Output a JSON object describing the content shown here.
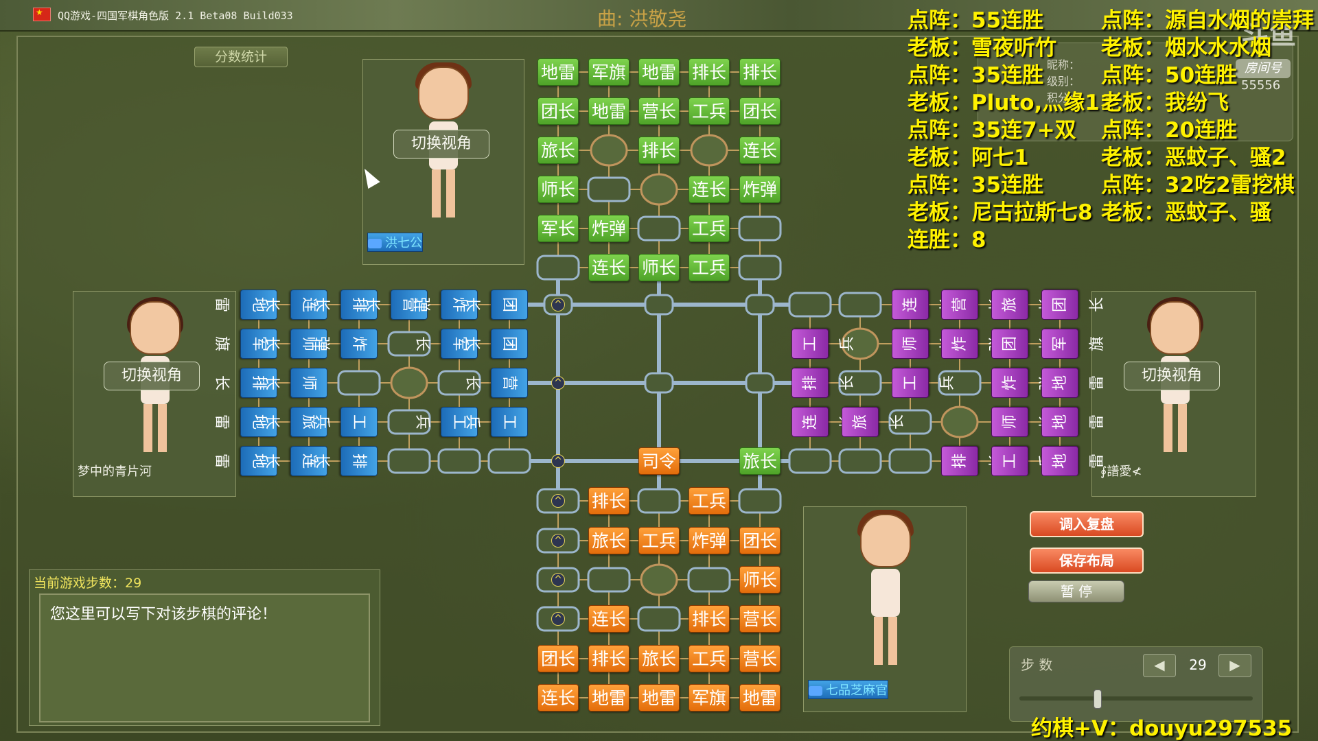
{
  "title_bar": {
    "app_title": "QQ游戏-四国军棋角色版 2.1 Beta08 Build033",
    "song": "曲: 洪敬尧"
  },
  "score_button": "分数统计",
  "players": {
    "top": {
      "name": "洪七公",
      "view_button": "切换视角"
    },
    "left": {
      "name": "梦中的青片河",
      "view_button": "切换视角"
    },
    "right": {
      "name": "∮譜愛≮",
      "view_button": "切换视角"
    },
    "bottom": {
      "name": "七品芝麻官"
    }
  },
  "overlay_left": [
    "点阵：55连胜",
    "老板：雪夜听竹",
    "点阵：35连胜",
    "老板：Pluto,灬缘11",
    "点阵：35连7+双",
    "老板：阿七1",
    "点阵：35连胜",
    "老板：尼古拉斯七8",
    "连胜：8"
  ],
  "overlay_right": [
    "点阵：源自水烟的崇拜",
    "老板：烟水水水烟",
    "点阵：50连胜",
    "老板：我纷飞",
    "点阵：20连胜",
    "老板：恶蚊子、骚2",
    "点阵：32吃2雷挖棋",
    "老板：恶蚊子、骚"
  ],
  "room_info": {
    "nickname_label": "昵称：",
    "level_label": "级别：",
    "points_label": "积分：",
    "room_tag": "房间号",
    "room_number": "55556"
  },
  "logo": "斗鱼",
  "board": {
    "top_pieces": [
      [
        "地雷",
        "军旗",
        "地雷",
        "排长",
        "排长"
      ],
      [
        "团长",
        "地雷",
        "营长",
        "工兵",
        "团长"
      ],
      [
        "旅长",
        "",
        "排长",
        "",
        "连长"
      ],
      [
        "师长",
        "",
        "",
        "连长",
        "炸弹"
      ],
      [
        "军长",
        "炸弹",
        "",
        "工兵",
        ""
      ],
      [
        "",
        "连长",
        "师长",
        "工兵",
        ""
      ]
    ],
    "bottom_pieces": [
      [
        "",
        "排长",
        "",
        "工兵",
        ""
      ],
      [
        "",
        "旅长",
        "工兵",
        "炸弹",
        "团长"
      ],
      [
        "",
        "",
        "",
        "",
        "师长"
      ],
      [
        "",
        "连长",
        "",
        "排长",
        "营长"
      ],
      [
        "团长",
        "排长",
        "旅长",
        "工兵",
        "营长"
      ],
      [
        "连长",
        "地雷",
        "地雷",
        "军旗",
        "地雷"
      ]
    ],
    "left_pieces": [
      [
        "地雷",
        "连长",
        "排长",
        "营长",
        "炸弹",
        "团长"
      ],
      [
        "军旗",
        "师长",
        "炸弹",
        "",
        "军长",
        "团长"
      ],
      [
        "排长",
        "师长",
        "",
        "",
        "",
        "营长"
      ],
      [
        "地雷",
        "旅长",
        "工兵",
        "",
        "工兵",
        "工兵"
      ],
      [
        "地雷",
        "连长",
        "排长",
        "",
        "",
        ""
      ]
    ],
    "right_pieces": [
      [
        "",
        "",
        "连长",
        "营长",
        "旅长",
        "团长"
      ],
      [
        "工兵",
        "",
        "师长",
        "炸弹",
        "团长",
        "军旗"
      ],
      [
        "排长",
        "",
        "工兵",
        "",
        "炸弹",
        "地雷"
      ],
      [
        "连长",
        "旅长",
        "",
        "",
        "师长",
        "地雷"
      ],
      [
        "",
        "",
        "",
        "排长",
        "工兵",
        "地雷"
      ]
    ],
    "center_pieces": {
      "commander": "司令",
      "brigade": "旅长"
    },
    "marker_symbol": "^"
  },
  "step_panel": {
    "title": "当前游戏步数：29",
    "comment": "您这里可以写下对该步棋的评论！"
  },
  "buttons": {
    "load_replay": "调入复盘",
    "save_layout": "保存布局",
    "pause": "暂 停"
  },
  "step_control": {
    "label": "步  数",
    "value": "29",
    "prev": "◀",
    "next": "▶"
  },
  "footer_text": "约棋+V：douyu297535",
  "colors": {
    "top": "#5cb833",
    "bottom": "#f0841f",
    "left": "#2f86d2",
    "right": "#a53ec0",
    "overlay_text": "#fff200"
  }
}
